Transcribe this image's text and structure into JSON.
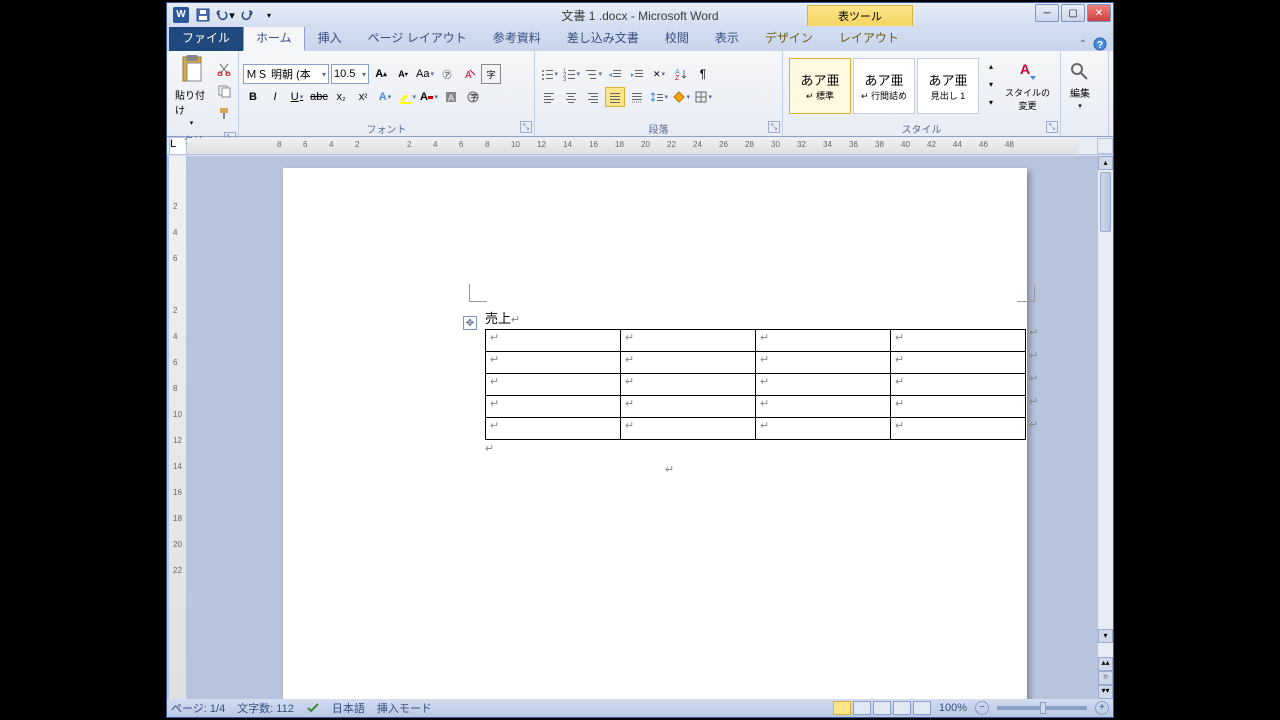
{
  "window": {
    "title": "文書 1 .docx - Microsoft Word",
    "context_tool": "表ツール"
  },
  "tabs": {
    "file": "ファイル",
    "home": "ホーム",
    "insert": "挿入",
    "page_layout": "ページ レイアウト",
    "references": "参考資料",
    "mailings": "差し込み文書",
    "review": "校閲",
    "view": "表示",
    "design": "デザイン",
    "layout": "レイアウト"
  },
  "ribbon": {
    "clipboard": {
      "label": "クリッ...",
      "paste": "貼り付け"
    },
    "font": {
      "label": "フォント",
      "name": "ＭＳ 明朝 (本",
      "size": "10.5"
    },
    "paragraph": {
      "label": "段落"
    },
    "styles": {
      "label": "スタイル",
      "preview": "あア亜",
      "normal": "↵ 標準",
      "nospace": "↵ 行間詰め",
      "heading1": "見出し 1",
      "change": "スタイルの変更"
    },
    "editing": {
      "label": "編集"
    }
  },
  "ruler": {
    "top_marks": [
      "8",
      "6",
      "4",
      "2",
      "",
      "2",
      "4",
      "6",
      "8",
      "10",
      "12",
      "14",
      "16",
      "18",
      "20",
      "22",
      "24",
      "26",
      "28",
      "30",
      "32",
      "34",
      "36",
      "38",
      "40",
      "42",
      "44",
      "46",
      "48"
    ],
    "left_marks": [
      "",
      "2",
      "4",
      "6",
      "",
      "2",
      "4",
      "6",
      "8",
      "10",
      "12",
      "14",
      "16",
      "18",
      "20",
      "22"
    ]
  },
  "document": {
    "line1": "売上",
    "return_char": "↵",
    "cell_char": "↵",
    "table": {
      "rows": 5,
      "cols": 4
    }
  },
  "status": {
    "page": "ページ: 1/4",
    "words": "文字数: 112",
    "lang": "日本語",
    "mode": "挿入モード",
    "zoom": "100%"
  }
}
